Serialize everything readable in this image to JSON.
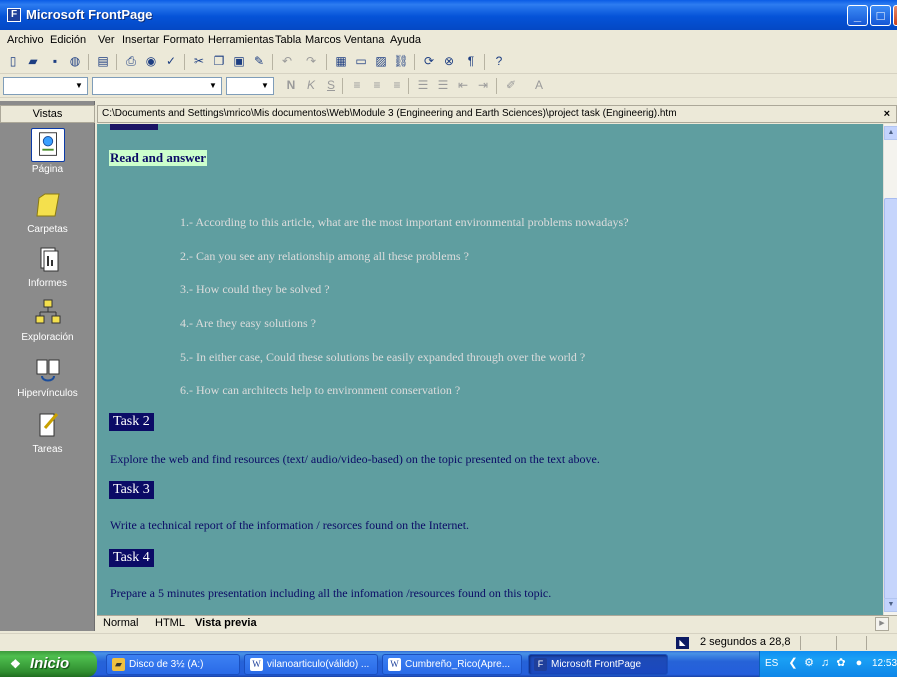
{
  "window": {
    "title": "Microsoft FrontPage",
    "controls": {
      "minimize": "_",
      "maximize": "□",
      "close": "X"
    }
  },
  "menu": [
    "Archivo",
    "Edición",
    "Ver",
    "Insertar",
    "Formato",
    "Herramientas",
    "Tabla",
    "Marcos",
    "Ventana",
    "Ayuda"
  ],
  "views_panel": {
    "header": "Vistas",
    "items": [
      {
        "label": "Página",
        "icon": "page-view-icon"
      },
      {
        "label": "Carpetas",
        "icon": "folders-icon"
      },
      {
        "label": "Informes",
        "icon": "reports-icon"
      },
      {
        "label": "Exploración",
        "icon": "navigation-icon"
      },
      {
        "label": "Hipervínculos",
        "icon": "hyperlinks-icon"
      },
      {
        "label": "Tareas",
        "icon": "tasks-icon"
      }
    ]
  },
  "path": "C:\\Documents and Settings\\mrico\\Mis documentos\\Web\\Module 3 (Engineering and Earth Sciences)\\project task (Engineerig).htm",
  "document": {
    "heading": "Read and answer",
    "questions": [
      "1.- According to this article, what are the most important environmental problems nowadays?",
      "2.- Can you see any relationship among all these problems ?",
      "3.- How could they be solved ?",
      "4.- Are they easy solutions ?",
      "5.- In either case, Could these solutions be easily expanded through over the world ?",
      "6.- How can architects help to environment conservation ?"
    ],
    "tasks": [
      {
        "title": "Task 2",
        "text": "Explore the web and find resources (text/ audio/video-based) on the topic presented on the text above."
      },
      {
        "title": "Task 3",
        "text": "Write a technical report of the information / resorces found on the Internet."
      },
      {
        "title": "Task 4",
        "text": "Prepare a 5 minutes presentation including all the infomation /resources found on this topic."
      }
    ]
  },
  "view_tabs": [
    "Normal",
    "HTML",
    "Vista previa"
  ],
  "status": {
    "text": "2 segundos a 28,8"
  },
  "taskbar": {
    "start": "Inicio",
    "tasks": [
      "Disco de 3½ (A:)",
      "vilanoarticulo(válido) ...",
      "Cumbreño_Rico(Apre...",
      "Microsoft FrontPage"
    ],
    "tray": {
      "language": "ES",
      "clock": "12:53"
    }
  },
  "colors": {
    "doc_background": "#5f9ea0",
    "task_heading_bg": "#0b0b66",
    "heading_highlight": "#ccffcc"
  }
}
